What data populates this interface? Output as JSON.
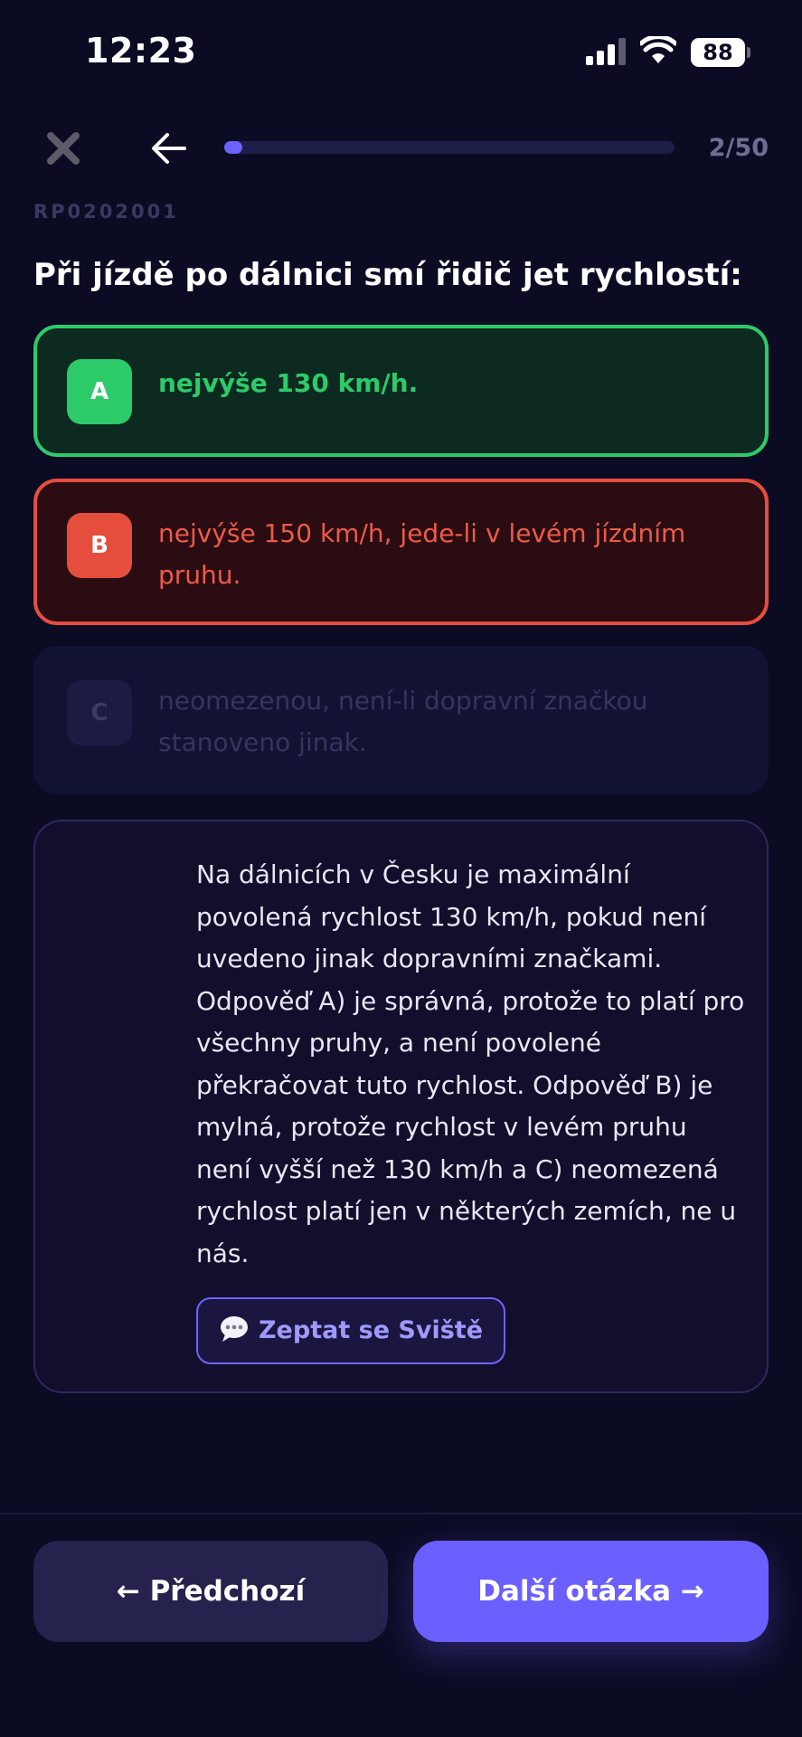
{
  "status_bar": {
    "time": "12:23",
    "battery": "88"
  },
  "nav": {
    "progress_text": "2/50",
    "progress_fraction": 0.04
  },
  "question": {
    "code": "RP0202001",
    "text": "Při jízdě po dálnici smí řidič jet rychlostí:"
  },
  "answers": [
    {
      "letter": "A",
      "text": "nejvýše 130 km/h.",
      "state": "correct"
    },
    {
      "letter": "B",
      "text": "nejvýše 150 km/h, jede-li v levém jízdním pruhu.",
      "state": "wrong"
    },
    {
      "letter": "C",
      "text": "neomezenou, není-li dopravní značkou stanoveno jinak.",
      "state": "inactive"
    }
  ],
  "explanation": {
    "text": "Na dálnicích v Česku je maximální povolená rychlost 130 km/h, pokud není uvedeno jinak dopravními značkami. Odpověď A) je správná, protože to platí pro všechny pruhy, a není povolené překračovat tuto rychlost. Odpověď B) je mylná, protože rychlost v levém pruhu není vyšší než 130 km/h a C) neomezená rychlost platí jen v některých zemích, ne u nás.",
    "ask_label": "Zeptat se Sviště"
  },
  "footer": {
    "prev_label": "← Předchozí",
    "next_label": "Další otázka →"
  },
  "colors": {
    "background": "#0c0b24",
    "accent": "#6c5fff",
    "correct": "#2dca6a",
    "wrong": "#e54e3d"
  }
}
